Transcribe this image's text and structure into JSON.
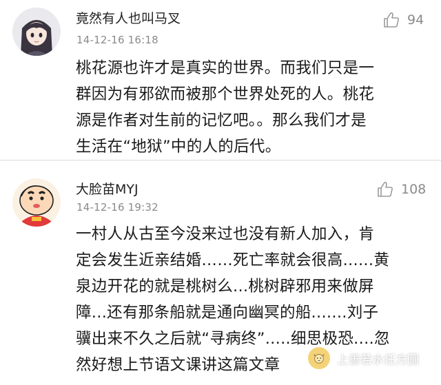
{
  "comments": [
    {
      "username": "竟然有人也叫马叉",
      "timestamp": "14-12-16 16:18",
      "likes": "94",
      "avatar_icon": "anime-girl-avatar-icon",
      "lines": [
        "桃花源也许才是真实的世界。而我们只是一",
        "群因为有邪欲而被那个世界处死的人。桃花",
        "源是作者对生前的记忆吧。。那么我们才是",
        "生活在“地狱”中的人的后代。"
      ]
    },
    {
      "username": "大脸苗MYJ",
      "timestamp": "14-12-16 19:32",
      "likes": "108",
      "avatar_icon": "crayon-shinchan-avatar-icon",
      "lines": [
        "一村人从古至今没来过也没有新人加入，肯",
        "定会发生近亲结婚……死亡率就会很高......黄",
        "泉边开花的就是桃树么...桃树辟邪用来做屏",
        "障...还有那条船就是通向幽冥的船.......刘子",
        "骥出来不久之后就“寻病终”.....细思极恐....忽",
        "然好想上节语文课讲这篇文章"
      ]
    }
  ],
  "watermark": {
    "text": "上善若水任方圆",
    "icon": "cat-face-icon"
  },
  "colors": {
    "username": "#222222",
    "timestamp": "#8a8a8a",
    "body": "#1a1a1a",
    "divider": "#dcdcdc"
  }
}
